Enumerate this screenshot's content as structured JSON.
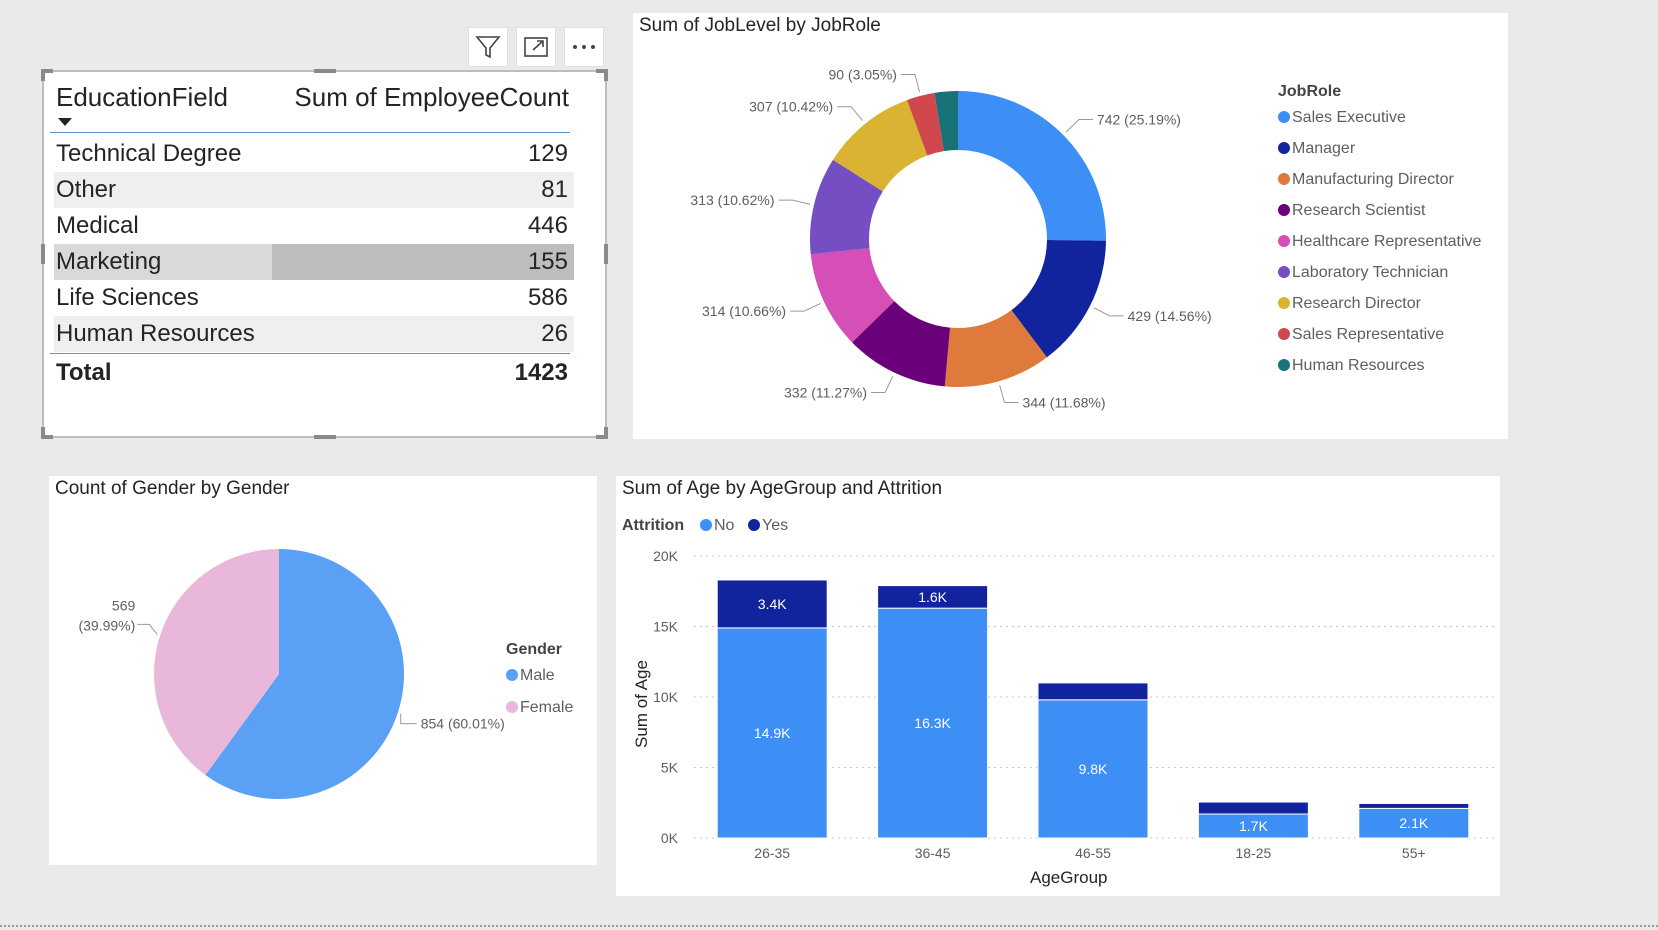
{
  "table": {
    "headers": [
      "EducationField",
      "Sum of EmployeeCount"
    ],
    "rows": [
      {
        "field": "Technical Degree",
        "count": "129"
      },
      {
        "field": "Other",
        "count": "81"
      },
      {
        "field": "Medical",
        "count": "446"
      },
      {
        "field": "Marketing",
        "count": "155"
      },
      {
        "field": "Life Sciences",
        "count": "586"
      },
      {
        "field": "Human Resources",
        "count": "26"
      }
    ],
    "total_label": "Total",
    "total_value": "1423"
  },
  "colors": {
    "sales_executive": "#3d8ef5",
    "manager": "#12239e",
    "manufacturing_director": "#e07a3c",
    "research_scientist": "#6b007b",
    "healthcare_representative": "#d64fb6",
    "laboratory_technician": "#744ec2",
    "research_director": "#d9b331",
    "sales_representative": "#d1484c",
    "human_resources": "#197278",
    "male": "#5aa0f5",
    "female": "#e8b7da",
    "attrition_no": "#3d8ef5",
    "attrition_yes": "#12239e"
  },
  "chart_data": [
    {
      "type": "pie",
      "donut": true,
      "title": "Sum of JobLevel by JobRole",
      "legend_title": "JobRole",
      "legend_position": "right",
      "slices": [
        {
          "name": "Sales Executive",
          "value": 742,
          "label": "742 (25.19%)"
        },
        {
          "name": "Manager",
          "value": 429,
          "label": "429 (14.56%)"
        },
        {
          "name": "Manufacturing Director",
          "value": 344,
          "label": "344 (11.68%)"
        },
        {
          "name": "Research Scientist",
          "value": 332,
          "label": "332 (11.27%)"
        },
        {
          "name": "Healthcare Representative",
          "value": 314,
          "label": "314 (10.66%)"
        },
        {
          "name": "Laboratory Technician",
          "value": 313,
          "label": "313 (10.62%)"
        },
        {
          "name": "Research Director",
          "value": 307,
          "label": "307 (10.42%)"
        },
        {
          "name": "Sales Representative",
          "value": 90,
          "label": "90 (3.05%)"
        },
        {
          "name": "Human Resources",
          "value": 75,
          "label": ""
        }
      ]
    },
    {
      "type": "pie",
      "title": "Count of Gender by Gender",
      "legend_title": "Gender",
      "legend_position": "right",
      "slices": [
        {
          "name": "Male",
          "value": 854,
          "label": "854 (60.01%)"
        },
        {
          "name": "Female",
          "value": 569,
          "label_line1": "569",
          "label_line2": "(39.99%)"
        }
      ]
    },
    {
      "type": "bar",
      "stacked": true,
      "title": "Sum of Age by AgeGroup and Attrition",
      "legend_title": "Attrition",
      "legend_position": "top-left",
      "xlabel": "AgeGroup",
      "ylabel": "Sum of Age",
      "ylim": [
        0,
        20000
      ],
      "yticks": [
        "0K",
        "5K",
        "10K",
        "15K",
        "20K"
      ],
      "categories": [
        "26-35",
        "36-45",
        "46-55",
        "18-25",
        "55+"
      ],
      "series": [
        {
          "name": "No",
          "values": [
            14900,
            16300,
            9800,
            1700,
            2100
          ],
          "labels": [
            "14.9K",
            "16.3K",
            "9.8K",
            "1.7K",
            "2.1K"
          ]
        },
        {
          "name": "Yes",
          "values": [
            3400,
            1600,
            1200,
            850,
            350
          ],
          "labels": [
            "3.4K",
            "1.6K",
            "",
            "",
            ""
          ]
        }
      ]
    }
  ]
}
